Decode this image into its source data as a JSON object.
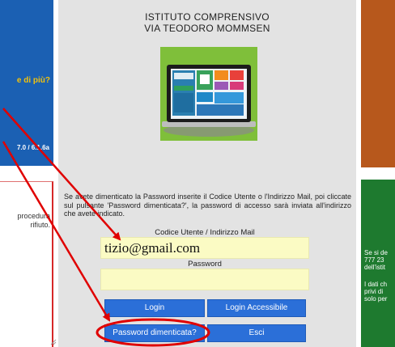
{
  "left": {
    "promo_text": "e di più?",
    "version_text": "7.0 / 6.1.6a",
    "notice_lines": [
      "procedura",
      "rifiuto."
    ]
  },
  "school": {
    "title_line1": "ISTITUTO COMPRENSIVO",
    "title_line2": "VIA TEODORO MOMMSEN"
  },
  "login_form": {
    "info_text": "Se avete dimenticato la Password inserite il Codice Utente o l'Indirizzo Mail, poi cliccate sul pulsante 'Password dimenticata?', la password di accesso sarà inviata all'indirizzo che avete indicato.",
    "user_label": "Codice Utente / Indirizzo Mail",
    "user_value": "tizio@gmail.com",
    "password_label": "Password",
    "password_value": "",
    "login_button": "Login",
    "login_accessible_button": "Login Accessibile",
    "forgot_password_button": "Password dimenticata?",
    "exit_button": "Esci"
  },
  "right": {
    "green_lines_a": [
      "Se si de",
      "777 23",
      "dell'istit"
    ],
    "green_lines_b": [
      "I dati ch",
      "privi di",
      "solo per"
    ]
  },
  "colors": {
    "left_blue": "#1b60b3",
    "promo_yellow": "#f2c20d",
    "right_orange": "#b7581c",
    "right_green": "#1e7a2f",
    "button_blue": "#2b6fd8",
    "input_yellow": "#fbfbc4",
    "annotation_red": "#e00000"
  }
}
